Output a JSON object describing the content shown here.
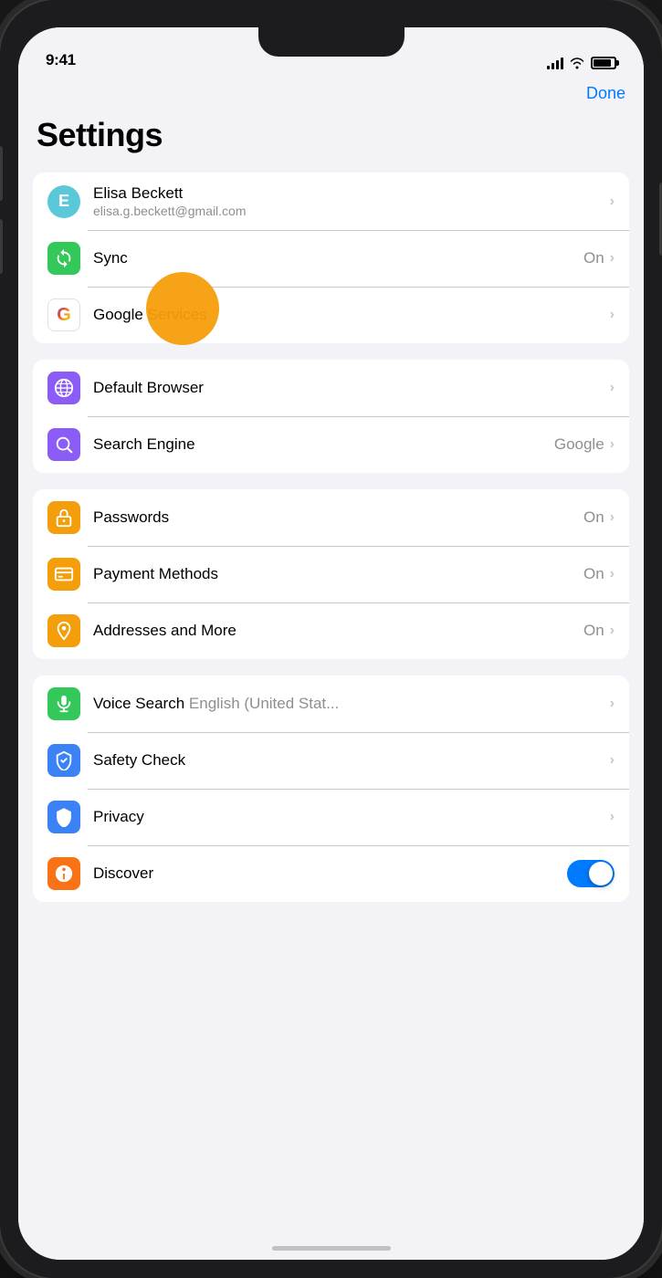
{
  "statusBar": {
    "time": "9:41"
  },
  "header": {
    "doneLabel": "Done",
    "title": "Settings"
  },
  "groups": [
    {
      "id": "account",
      "rows": [
        {
          "id": "account-user",
          "iconType": "avatar",
          "iconLetter": "E",
          "title": "Elisa Beckett",
          "subtitle": "elisa.g.beckett@gmail.com",
          "rightText": "",
          "showChevron": true
        },
        {
          "id": "sync",
          "iconType": "sync",
          "title": "Sync",
          "rightText": "On",
          "showChevron": true
        },
        {
          "id": "google-services",
          "iconType": "google",
          "title": "Google Services",
          "rightText": "",
          "showChevron": true
        }
      ]
    },
    {
      "id": "browser",
      "rows": [
        {
          "id": "default-browser",
          "iconType": "browser",
          "title": "Default Browser",
          "rightText": "",
          "showChevron": true
        },
        {
          "id": "search-engine",
          "iconType": "search",
          "title": "Search Engine",
          "rightText": "Google",
          "showChevron": true
        }
      ]
    },
    {
      "id": "autofill",
      "rows": [
        {
          "id": "passwords",
          "iconType": "passwords",
          "title": "Passwords",
          "rightText": "On",
          "showChevron": true
        },
        {
          "id": "payment-methods",
          "iconType": "payment",
          "title": "Payment Methods",
          "rightText": "On",
          "showChevron": true
        },
        {
          "id": "addresses",
          "iconType": "address",
          "title": "Addresses and More",
          "rightText": "On",
          "showChevron": true
        }
      ]
    },
    {
      "id": "misc",
      "rows": [
        {
          "id": "voice-search",
          "iconType": "voice",
          "title": "Voice Search",
          "titleSuffix": "English (United Stat...",
          "rightText": "",
          "showChevron": true
        },
        {
          "id": "safety-check",
          "iconType": "safety",
          "title": "Safety Check",
          "rightText": "",
          "showChevron": true
        },
        {
          "id": "privacy",
          "iconType": "privacy",
          "title": "Privacy",
          "rightText": "",
          "showChevron": true
        },
        {
          "id": "discover",
          "iconType": "discover",
          "title": "Discover",
          "rightText": "",
          "showChevron": false,
          "hasToggle": true,
          "toggleOn": true
        }
      ]
    }
  ],
  "icons": {
    "sync": "↻",
    "browser": "🌐",
    "search": "🔍",
    "key": "🔑",
    "card": "💳",
    "pin": "📍",
    "mic": "🎤",
    "shield": "🛡",
    "privacy": "🛡",
    "fire": "🔥"
  }
}
